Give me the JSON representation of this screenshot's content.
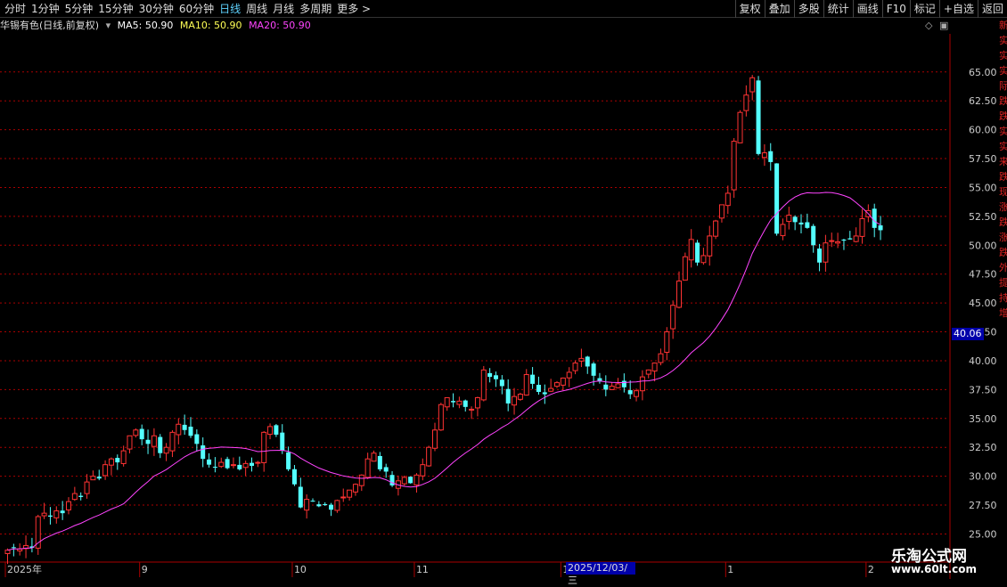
{
  "toolbar": {
    "tabs": [
      "分时",
      "1分钟",
      "5分钟",
      "15分钟",
      "30分钟",
      "60分钟",
      "日线",
      "周线",
      "月线",
      "多周期",
      "更多 >"
    ],
    "active_tab": "日线",
    "right_buttons": [
      "复权",
      "叠加",
      "多股",
      "统计",
      "画线",
      "F10",
      "标记",
      "+自选",
      "返回"
    ]
  },
  "info": {
    "title": "华锡有色(日线,前复权)",
    "ma5": "MA5: 50.90",
    "ma10": "MA10: 50.90",
    "ma20": "MA20: 50.90"
  },
  "colors": {
    "up": "#ff3333",
    "down": "#54ffff",
    "ma5": "#ffffff",
    "ma10": "#ffff55",
    "ma20": "#ff44ff",
    "grid": "#aa0000",
    "axis_text": "#cccccc"
  },
  "price_tag": "40.06",
  "date_tag": "2025/12/03/三",
  "watermark": {
    "title": "乐淘公式网",
    "url": "www.60lt.com"
  },
  "side_text": "新实实实际跌跌实实来跌现涨跌涨跌外提持增",
  "chart_data": {
    "type": "candlestick",
    "y_ticks": [
      25.0,
      27.5,
      30.0,
      32.5,
      35.0,
      37.5,
      40.0,
      42.5,
      45.0,
      47.5,
      50.0,
      52.5,
      55.0,
      57.5,
      60.0,
      62.5,
      65.0
    ],
    "y_range": [
      22.8,
      68.3
    ],
    "x_labels": [
      {
        "label": "2025年",
        "index": 0
      },
      {
        "label": "9",
        "index": 22
      },
      {
        "label": "10",
        "index": 47
      },
      {
        "label": "11",
        "index": 67
      },
      {
        "label": "12",
        "index": 91
      },
      {
        "label": "1",
        "index": 118
      },
      {
        "label": "2",
        "index": 141
      }
    ],
    "closes": [
      23.6,
      23.8,
      23.7,
      24.0,
      23.8,
      26.5,
      26.8,
      26.5,
      27.0,
      26.8,
      27.8,
      28.5,
      28.2,
      29.5,
      30.0,
      29.8,
      31.0,
      31.5,
      31.2,
      32.2,
      33.5,
      34.0,
      33.2,
      32.8,
      33.5,
      32.0,
      32.5,
      33.8,
      34.5,
      34.0,
      33.5,
      32.8,
      31.5,
      31.0,
      30.8,
      31.2,
      30.7,
      31.0,
      30.6,
      31.1,
      30.9,
      31.2,
      33.8,
      34.3,
      33.6,
      32.2,
      30.6,
      29.3,
      27.3,
      28.0,
      27.8,
      27.4,
      27.5,
      27.1,
      27.9,
      28.2,
      28.8,
      29.3,
      30.1,
      31.5,
      32.0,
      30.6,
      30.4,
      29.2,
      29.6,
      29.9,
      29.4,
      30.1,
      31.0,
      32.5,
      34.0,
      36.2,
      36.8,
      36.4,
      36.5,
      36.0,
      35.8,
      36.8,
      39.2,
      38.6,
      38.4,
      37.8,
      36.3,
      36.9,
      37.1,
      38.8,
      38.0,
      37.3,
      37.1,
      37.6,
      38.1,
      38.5,
      39.0,
      39.8,
      40.2,
      39.5,
      38.7,
      38.2,
      37.5,
      37.8,
      38.0,
      37.7,
      37.1,
      37.4,
      38.6,
      39.2,
      39.8,
      40.6,
      42.5,
      44.8,
      46.9,
      49.0,
      50.5,
      48.5,
      49.1,
      50.8,
      52.1,
      53.5,
      54.5,
      59.0,
      61.5,
      63.0,
      64.5,
      57.9,
      58.0,
      57.2,
      51.0,
      51.8,
      52.6,
      52.0,
      51.8,
      51.5,
      50.0,
      48.5,
      50.2,
      50.4,
      50.3,
      50.4,
      50.5,
      50.8,
      52.3,
      53.0,
      51.5,
      51.3
    ],
    "ma_flat": 50.9
  }
}
